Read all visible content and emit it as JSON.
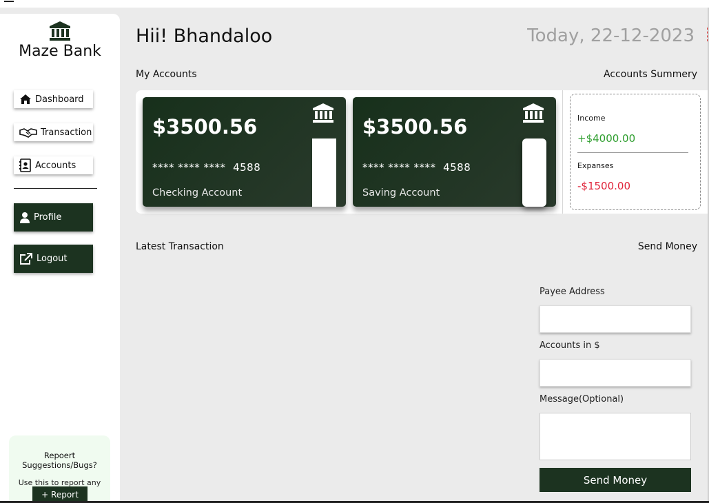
{
  "app": {
    "brand": "Maze Bank",
    "bank_icon": "bank-icon"
  },
  "sidebar": {
    "nav": [
      {
        "label": "Dashboard",
        "icon": "home-icon"
      },
      {
        "label": "Transaction",
        "icon": "handshake-icon"
      },
      {
        "label": "Accounts",
        "icon": "contact-book-icon"
      }
    ],
    "profile_label": "Profile",
    "logout_label": "Logout",
    "report": {
      "title": "Repoert Suggestions/Bugs?",
      "text": "Use this to report any err...",
      "button_label": "+ Report"
    }
  },
  "header": {
    "greeting": "Hii! Bhandaloo",
    "date": "Today, 22-12-2023"
  },
  "sections": {
    "my_accounts": "My Accounts",
    "accounts_summary": "Accounts Summery",
    "latest_transaction": "Latest Transaction",
    "send_money": "Send Money"
  },
  "cards": [
    {
      "balance": "$3500.56",
      "mask": "**** **** ****",
      "last4": "4588",
      "type": "Checking Account"
    },
    {
      "balance": "$3500.56",
      "mask": "**** **** ****",
      "last4": "4588",
      "type": "Saving Account"
    }
  ],
  "summary": {
    "income_label": "Income",
    "income_value": "+$4000.00",
    "expenses_label": "Expanses",
    "expenses_value": "-$1500.00"
  },
  "send_form": {
    "payee_label": "Payee Address",
    "payee_value": "",
    "amount_label": "Accounts in $",
    "amount_value": "",
    "message_label": "Message(Optional)",
    "message_value": "",
    "submit_label": "Send Money"
  },
  "colors": {
    "primary_dark": "#1c3320",
    "income": "#2e9e2e",
    "expense": "#e0243a",
    "date_text": "#a0a0a0"
  }
}
